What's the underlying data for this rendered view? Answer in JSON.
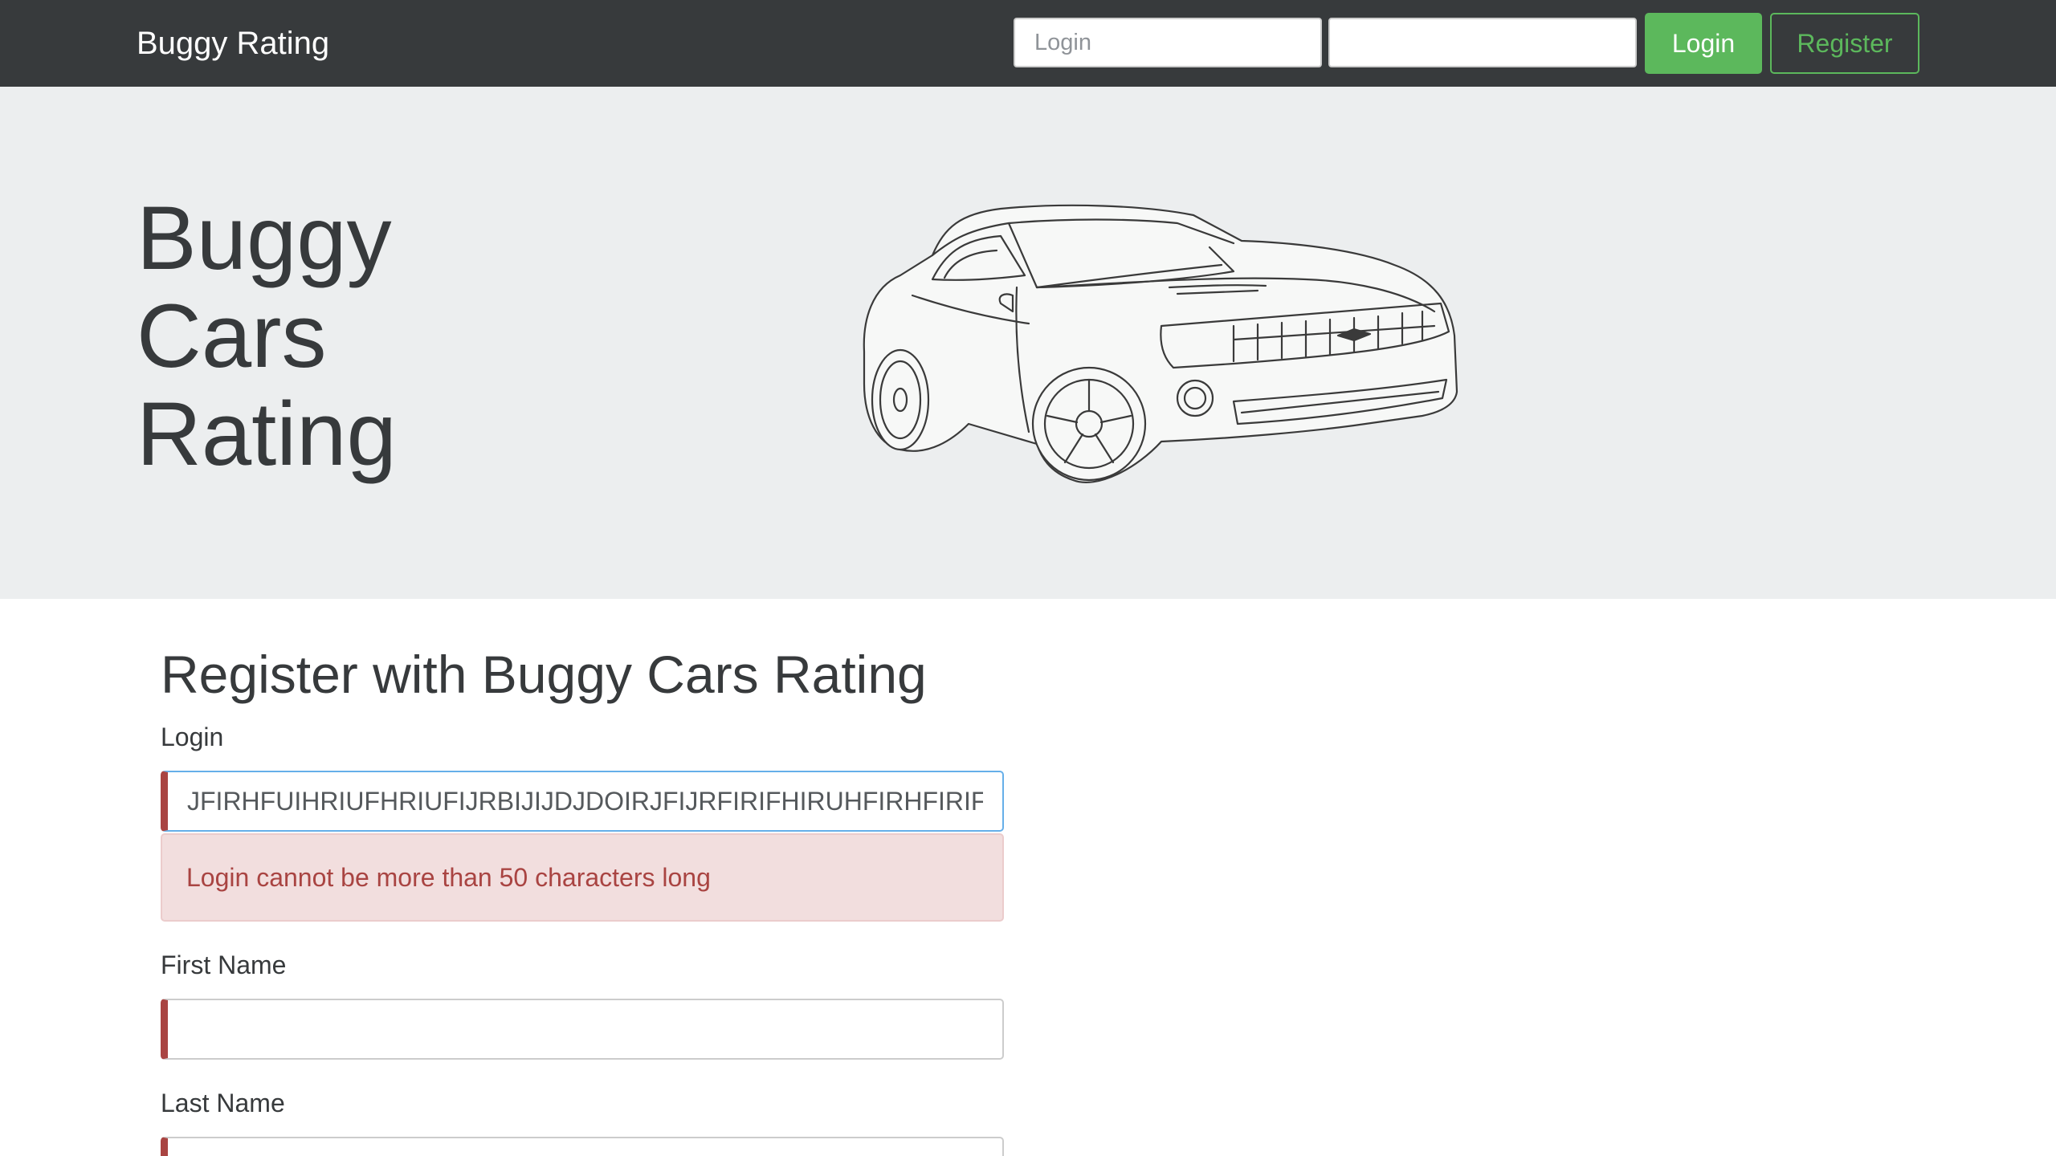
{
  "navbar": {
    "brand": "Buggy Rating",
    "login_placeholder": "Login",
    "password_value": "",
    "login_button": "Login",
    "register_button": "Register",
    "accent_color": "#5cb85c"
  },
  "hero": {
    "title_lines": [
      "Buggy",
      "Cars",
      "Rating"
    ],
    "image": "car-line-drawing"
  },
  "form": {
    "title": "Register with Buggy Cars Rating",
    "login": {
      "label": "Login",
      "value": "JFIRHFUIHRIUFHRIUFIJRBIJIJDJDOIRJFIJRFIRIFHIRUHFIRHFIRIF",
      "error": "Login cannot be more than 50 characters long"
    },
    "first_name": {
      "label": "First Name",
      "value": ""
    },
    "last_name": {
      "label": "Last Name",
      "value": ""
    },
    "error_color": "#a94442"
  }
}
